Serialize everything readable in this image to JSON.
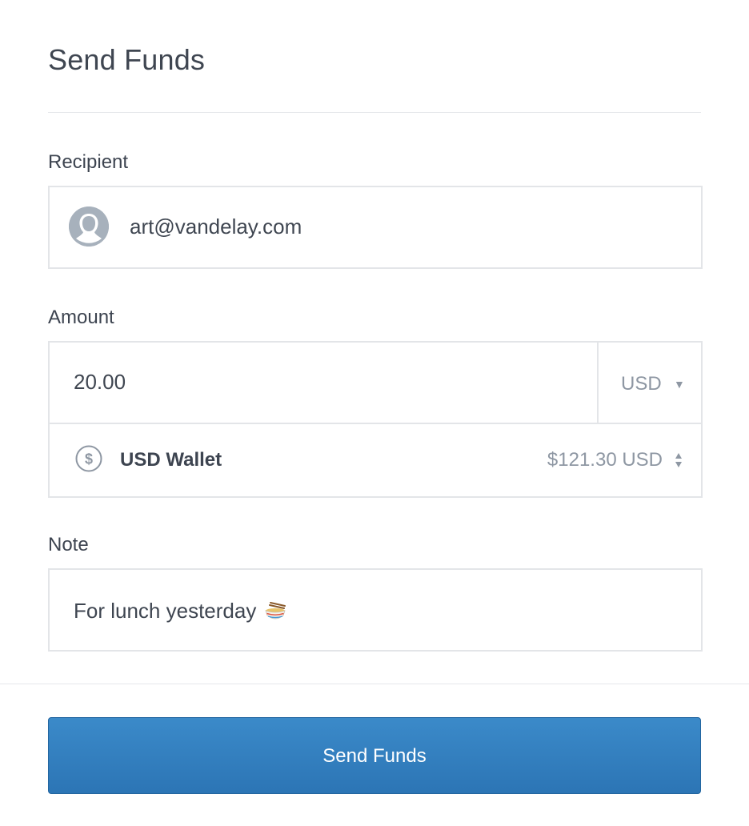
{
  "header": {
    "title": "Send Funds"
  },
  "recipient": {
    "label": "Recipient",
    "value": "art@vandelay.com",
    "avatar_icon": "user-silhouette-icon"
  },
  "amount": {
    "label": "Amount",
    "value": "20.00",
    "currency": "USD",
    "currency_icon": "caret-down-icon"
  },
  "wallet": {
    "icon": "dollar-circle-icon",
    "name": "USD Wallet",
    "balance": "$121.30 USD",
    "selector_icon": "up-down-arrows-icon"
  },
  "note": {
    "label": "Note",
    "value": "For lunch yesterday",
    "emoji_icon": "noodle-bowl-icon"
  },
  "actions": {
    "submit_label": "Send Funds"
  },
  "colors": {
    "primary_button": "#3b8ac9",
    "muted_text": "#8e97a3",
    "border": "#e3e5e8"
  }
}
